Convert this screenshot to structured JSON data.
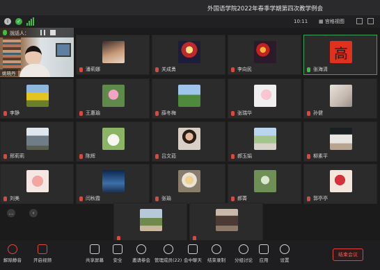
{
  "window": {
    "title": "外国语学院2022年春季学期第四次教学例会"
  },
  "infobar": {
    "time": "10:11",
    "view_label": "宫格视图"
  },
  "speaker": {
    "label": "說話人：",
    "name": "姚晓丹"
  },
  "participants": [
    {
      "name": "",
      "avatar": "speaker-video"
    },
    {
      "name": "潘莉娜",
      "avatar": "photo-girl"
    },
    {
      "name": "关成勇",
      "avatar": "photo-christmas"
    },
    {
      "name": "李向民",
      "avatar": "photo-lantern"
    },
    {
      "name": "张海清",
      "avatar": "char-gao",
      "avatar_text": "高",
      "highlight": true
    },
    {
      "name": "李静",
      "avatar": "photo-sunflowers"
    },
    {
      "name": "王惠瑜",
      "avatar": "photo-lotus"
    },
    {
      "name": "薛冬梅",
      "avatar": "photo-landscape"
    },
    {
      "name": "张瑞华",
      "avatar": "photo-blossom"
    },
    {
      "name": "孙健",
      "avatar": "photo-room"
    },
    {
      "name": "邢莉莉",
      "avatar": "photo-building"
    },
    {
      "name": "陈辉",
      "avatar": "photo-white-dog"
    },
    {
      "name": "吕文茹",
      "avatar": "photo-woman"
    },
    {
      "name": "郝玉娟",
      "avatar": "photo-garden"
    },
    {
      "name": "柳素平",
      "avatar": "photo-snow-trees"
    },
    {
      "name": "刘美",
      "avatar": "photo-flower-pink"
    },
    {
      "name": "闫秋霞",
      "avatar": "photo-night-sky"
    },
    {
      "name": "张瑜",
      "avatar": "photo-bouquet"
    },
    {
      "name": "郝菁",
      "avatar": "photo-green"
    },
    {
      "name": "郭亭亭",
      "avatar": "photo-red-flower"
    },
    {
      "name": "",
      "avatar": "photo-path"
    },
    {
      "name": "",
      "avatar": "photo-person-standing"
    }
  ],
  "toolbar": {
    "items": [
      {
        "key": "unmute",
        "label": "解除静音"
      },
      {
        "key": "video",
        "label": "开启视频"
      },
      {
        "key": "share",
        "label": "共享屏幕"
      },
      {
        "key": "security",
        "label": "安全"
      },
      {
        "key": "invite",
        "label": "邀请参会"
      },
      {
        "key": "members",
        "label": "管理成员(22)"
      },
      {
        "key": "chat",
        "label": "会中聊天"
      },
      {
        "key": "record",
        "label": "结束录制"
      },
      {
        "key": "breakout",
        "label": "分组讨论"
      },
      {
        "key": "apps",
        "label": "应用"
      },
      {
        "key": "settings",
        "label": "设置"
      }
    ],
    "end_label": "结束会议"
  },
  "colors": {
    "accent_green": "#3da356",
    "end_red": "#e0453a",
    "mic_muted": "#d94a3d"
  }
}
